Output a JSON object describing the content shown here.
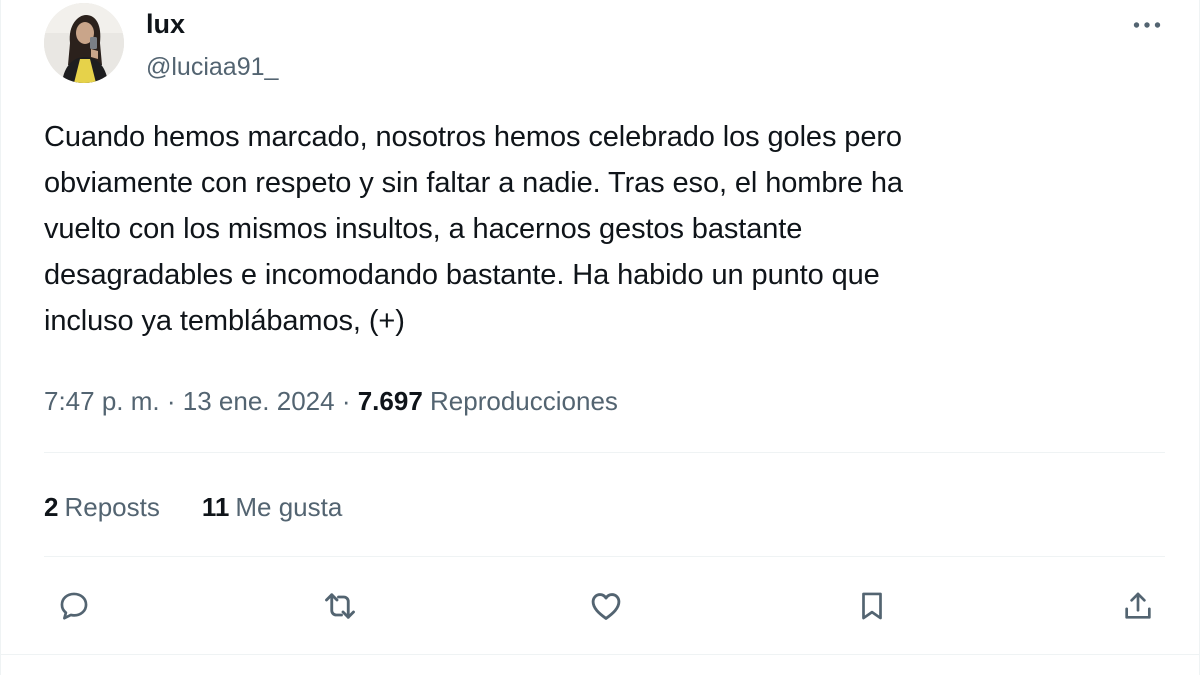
{
  "author": {
    "display_name": "lux",
    "handle": "@luciaa91_"
  },
  "tweet": {
    "text": "Cuando hemos marcado, nosotros hemos celebrado los goles pero\nobviamente con respeto y sin faltar a nadie. Tras eso, el hombre ha\nvuelto con los mismos insultos, a hacernos gestos bastante\ndesagradables e incomodando bastante. Ha habido un punto que\nincluso ya temblábamos, (+)"
  },
  "meta": {
    "time": "7:47 p. m.",
    "separator": "·",
    "date": "13 ene. 2024",
    "views_count": "7.697",
    "views_label": "Reproducciones"
  },
  "stats": {
    "reposts_count": "2",
    "reposts_label": "Reposts",
    "likes_count": "11",
    "likes_label": "Me gusta"
  },
  "icons": {
    "more": "more-horizontal-icon",
    "reply": "reply-icon",
    "repost": "repost-icon",
    "like": "heart-icon",
    "bookmark": "bookmark-icon",
    "share": "share-icon"
  },
  "colors": {
    "text": "#0f1419",
    "secondary_text": "#536471",
    "divider": "#eff3f4"
  }
}
